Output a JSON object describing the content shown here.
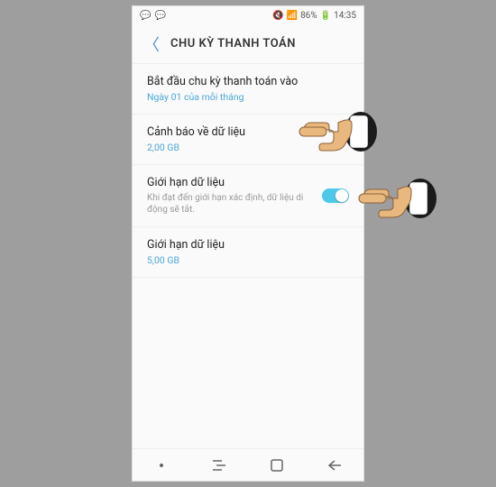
{
  "status_bar": {
    "time": "14:35",
    "battery": "86%"
  },
  "header": {
    "title": "CHU KỲ THANH TOÁN"
  },
  "settings": {
    "item1": {
      "title": "Bắt đầu chu kỳ thanh toán vào",
      "subtitle": "Ngày 01 của mỗi tháng"
    },
    "item2": {
      "title": "Cảnh báo về dữ liệu",
      "subtitle": "2,00 GB"
    },
    "item3": {
      "title": "Giới hạn dữ liệu",
      "desc": "Khi đạt đến giới hạn xác định, dữ liệu di động sẽ tắt."
    },
    "item4": {
      "title": "Giới hạn dữ liệu",
      "subtitle": "5,00 GB"
    }
  }
}
